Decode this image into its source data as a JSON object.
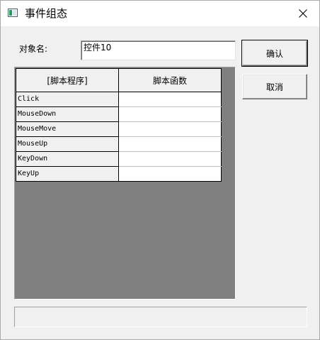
{
  "window": {
    "title": "事件组态",
    "icon": "app-window-icon",
    "close_icon": "close-icon"
  },
  "form": {
    "object_name_label": "对象名:",
    "object_name_value": "控件10"
  },
  "buttons": {
    "ok_label": "确认",
    "cancel_label": "取消"
  },
  "grid": {
    "columns": [
      "[脚本程序]",
      "脚本函数"
    ],
    "rows": [
      {
        "event": "Click",
        "function": ""
      },
      {
        "event": "MouseDown",
        "function": ""
      },
      {
        "event": "MouseMove",
        "function": ""
      },
      {
        "event": "MouseUp",
        "function": ""
      },
      {
        "event": "KeyDown",
        "function": ""
      },
      {
        "event": "KeyUp",
        "function": ""
      }
    ]
  },
  "status": {
    "text": ""
  }
}
